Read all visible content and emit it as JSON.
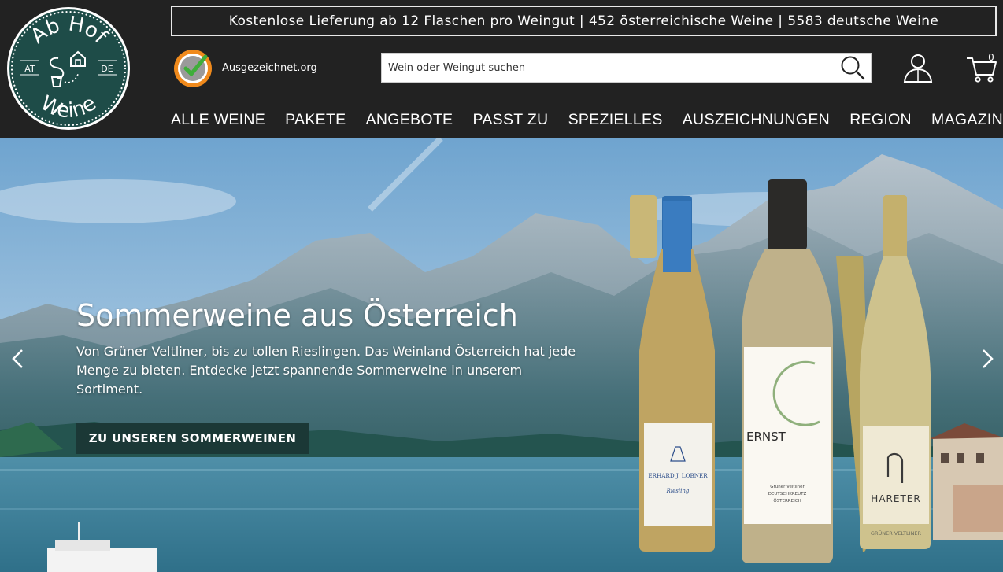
{
  "logo": {
    "top_text": "Ab Hof",
    "bottom_text": "Weine",
    "left_tag": "AT",
    "right_tag": "DE"
  },
  "promo_bar": {
    "text": "Kostenlose Lieferung ab 12 Flaschen pro Weingut | 452 österreichische Weine | 5583 deutsche Weine"
  },
  "badge": {
    "label": "Ausgezeichnet.org",
    "seal_text": "AUSGEZEICHNET.ORG"
  },
  "search": {
    "placeholder": "Wein oder Weingut suchen",
    "value": ""
  },
  "cart": {
    "count": "0"
  },
  "nav": {
    "items": [
      "ALLE WEINE",
      "PAKETE",
      "ANGEBOTE",
      "PASST ZU",
      "SPEZIELLES",
      "AUSZEICHNUNGEN",
      "REGION",
      "MAGAZIN"
    ]
  },
  "hero": {
    "title": "Sommerweine aus Österreich",
    "text": "Von Grüner Veltliner, bis zu tollen Rieslingen. Das Weinland Österreich hat jede Menge zu bieten. Entdecke jetzt spannende Sommerweine in unserem Sortiment.",
    "button_label": "ZU UNSEREN SOMMERWEINEN"
  },
  "bottles": [
    {
      "brand": "ERHARD J. LOBNER",
      "variety": "Riesling"
    },
    {
      "brand": "ERNST",
      "variety": "Grüner Veltliner",
      "origin": "DEUTSCHKREUTZ",
      "country": "ÖSTERREICH"
    },
    {
      "brand": "HARETER",
      "variety": "GRÜNER VELTLINER"
    }
  ],
  "colors": {
    "header_bg": "#222222",
    "accent_green": "#1b3836",
    "logo_bg": "#1e4c48"
  }
}
